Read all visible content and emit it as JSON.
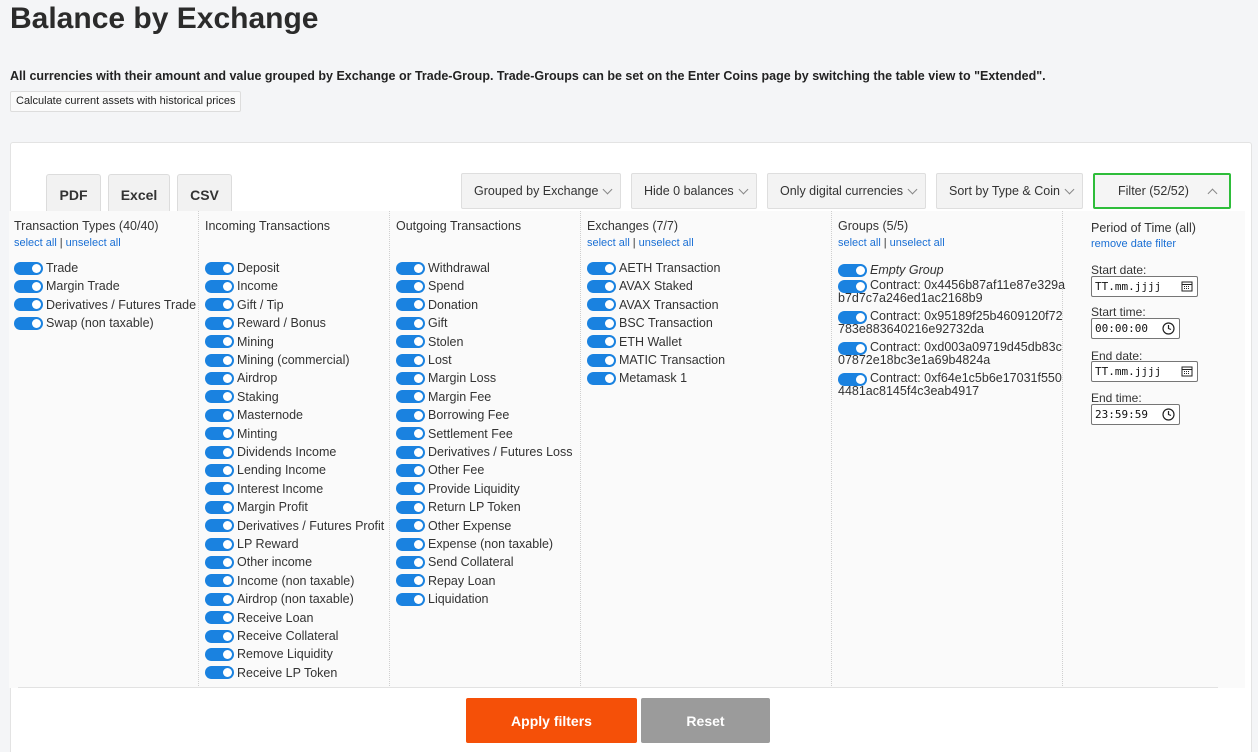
{
  "page": {
    "title": "Balance by Exchange",
    "description": "All currencies with their amount and value grouped by Exchange or Trade-Group. Trade-Groups can be set on the Enter Coins page by switching the table view to \"Extended\".",
    "historical_button": "Calculate current assets with historical prices"
  },
  "export": {
    "pdf": "PDF",
    "excel": "Excel",
    "csv": "CSV"
  },
  "toolbar": {
    "grouped": "Grouped by Exchange",
    "hide_zero": "Hide 0 balances",
    "only_digital": "Only digital currencies",
    "sort": "Sort by Type & Coin",
    "filter": "Filter (52/52)"
  },
  "filters": {
    "select_all": "select all",
    "unselect_all": "unselect all",
    "transaction_types": {
      "title": "Transaction Types (40/40)",
      "items": [
        "Trade",
        "Margin Trade",
        "Derivatives / Futures Trade",
        "Swap (non taxable)"
      ]
    },
    "incoming": {
      "title": "Incoming Transactions",
      "items": [
        "Deposit",
        "Income",
        "Gift / Tip",
        "Reward / Bonus",
        "Mining",
        "Mining (commercial)",
        "Airdrop",
        "Staking",
        "Masternode",
        "Minting",
        "Dividends Income",
        "Lending Income",
        "Interest Income",
        "Margin Profit",
        "Derivatives / Futures Profit",
        "LP Reward",
        "Other income",
        "Income (non taxable)",
        "Airdrop (non taxable)",
        "Receive Loan",
        "Receive Collateral",
        "Remove Liquidity",
        "Receive LP Token"
      ]
    },
    "outgoing": {
      "title": "Outgoing Transactions",
      "items": [
        "Withdrawal",
        "Spend",
        "Donation",
        "Gift",
        "Stolen",
        "Lost",
        "Margin Loss",
        "Margin Fee",
        "Borrowing Fee",
        "Settlement Fee",
        "Derivatives / Futures Loss",
        "Other Fee",
        "Provide Liquidity",
        "Return LP Token",
        "Other Expense",
        "Expense (non taxable)",
        "Send Collateral",
        "Repay Loan",
        "Liquidation"
      ]
    },
    "exchanges": {
      "title": "Exchanges (7/7)",
      "items": [
        "AETH Transaction",
        "AVAX Staked",
        "AVAX Transaction",
        "BSC Transaction",
        "ETH Wallet",
        "MATIC Transaction",
        "Metamask 1"
      ]
    },
    "groups": {
      "title": "Groups (5/5)",
      "empty": "Empty Group",
      "items": [
        {
          "l1": "Contract: 0x4456b87af11e87e329a",
          "l2": "b7d7c7a246ed1ac2168b9"
        },
        {
          "l1": "Contract: 0x95189f25b4609120f72",
          "l2": "783e883640216e92732da"
        },
        {
          "l1": "Contract: 0xd003a09719d45db83c",
          "l2": "07872e18bc3e1a69b4824a"
        },
        {
          "l1": "Contract: 0xf64e1c5b6e17031f550",
          "l2": "4481ac8145f4c3eab4917"
        }
      ]
    },
    "period": {
      "title": "Period of Time (all)",
      "remove": "remove date filter",
      "start_date_label": "Start date:",
      "start_date_value": "TT.mm.jjjj",
      "start_time_label": "Start time:",
      "start_time_value": "00:00:00",
      "end_date_label": "End date:",
      "end_date_value": "TT.mm.jjjj",
      "end_time_label": "End time:",
      "end_time_value": "23:59:59"
    }
  },
  "actions": {
    "apply": "Apply filters",
    "reset": "Reset"
  }
}
